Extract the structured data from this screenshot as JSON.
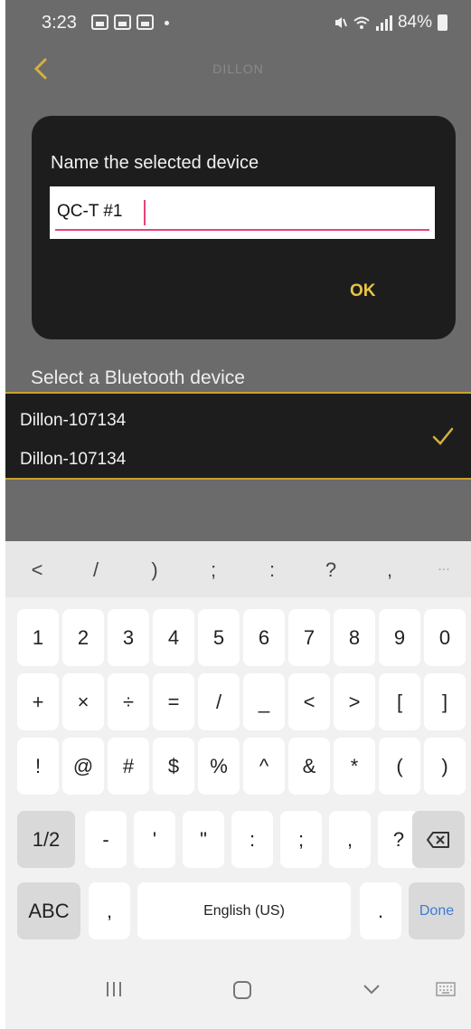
{
  "status_bar": {
    "time": "3:23",
    "battery": "84%",
    "icons": [
      "message-icon",
      "message-icon",
      "image-icon",
      "dot-icon",
      "mute-icon",
      "wifi-icon",
      "signal-icon",
      "battery-icon"
    ]
  },
  "app_bar": {
    "title": "DILLON",
    "back_icon": "chevron-left-icon"
  },
  "dialog": {
    "title": "Name the selected device",
    "input_value": "QC-T #1",
    "ok_label": "OK"
  },
  "section_label": "Select a Bluetooth device",
  "devices": [
    {
      "name": "Dillon-107134"
    },
    {
      "name": "Dillon-107134"
    }
  ],
  "keyboard": {
    "suggestions": [
      "<",
      "/",
      ")",
      ";",
      ":",
      "?",
      ",",
      "..."
    ],
    "row1": [
      "1",
      "2",
      "3",
      "4",
      "5",
      "6",
      "7",
      "8",
      "9",
      "0"
    ],
    "row2": [
      "+",
      "×",
      "÷",
      "=",
      "/",
      "_",
      "<",
      ">",
      "[",
      "]"
    ],
    "row3": [
      "!",
      "@",
      "#",
      "$",
      "%",
      "^",
      "&",
      "*",
      "(",
      ")"
    ],
    "row4": [
      "1/2",
      "-",
      "'",
      "\"",
      ":",
      ";",
      ",",
      "?"
    ],
    "row5": {
      "abc": "ABC",
      "comma": ",",
      "space": "English (US)",
      "period": ".",
      "done": "Done"
    }
  },
  "colors": {
    "accent": "#d4b040",
    "cursor": "#e5447c",
    "dialog_bg": "#1d1d1d",
    "done": "#3d7bd3"
  }
}
